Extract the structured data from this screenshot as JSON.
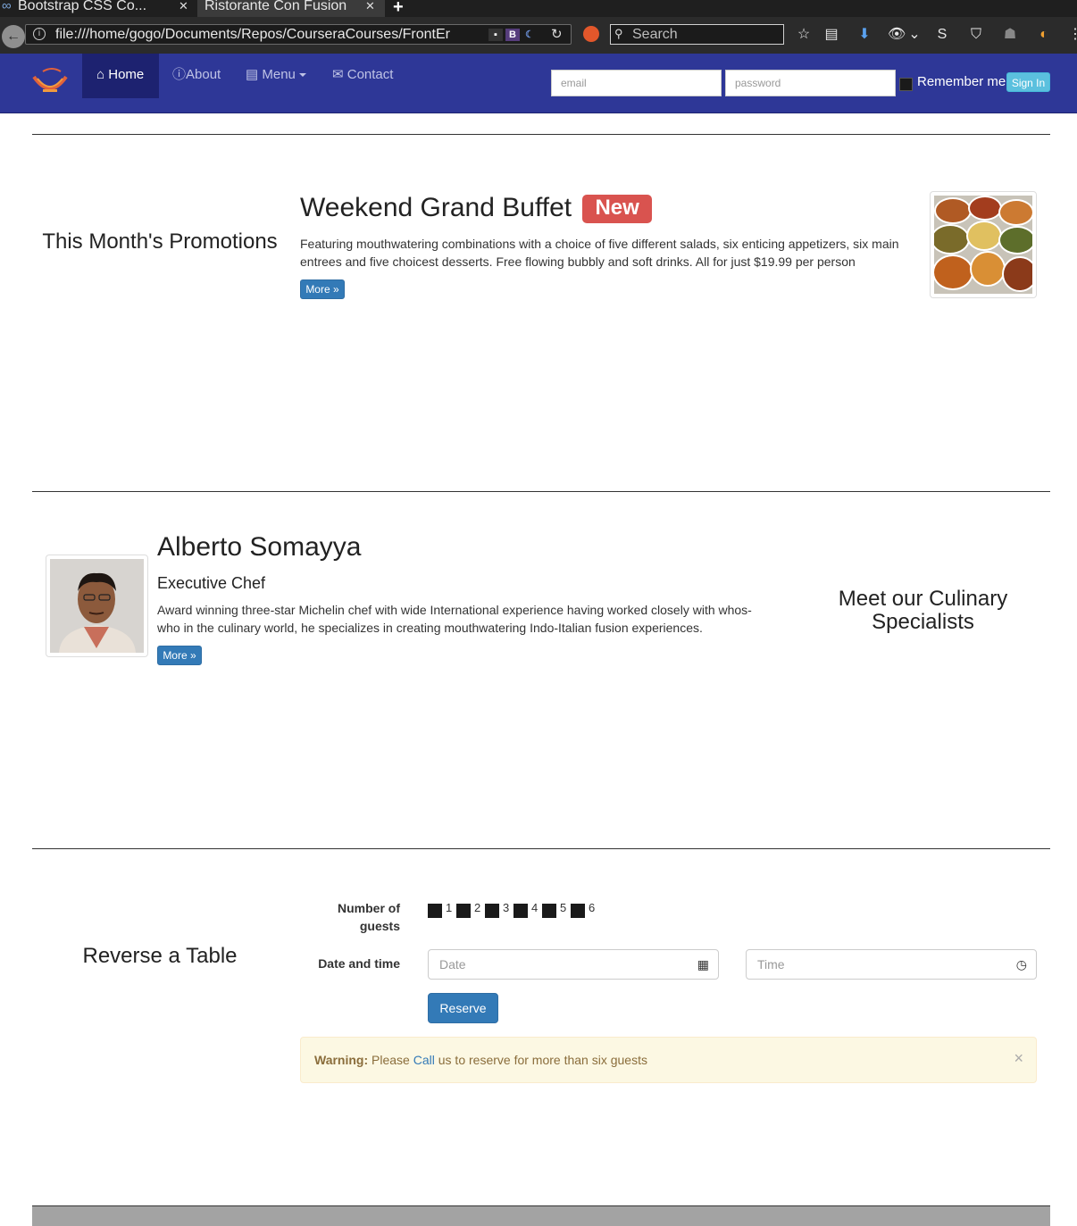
{
  "browser": {
    "tabs": [
      {
        "title": "Bootstrap CSS Co..."
      },
      {
        "title": "Ristorante Con Fusion"
      }
    ],
    "url": "file:///home/gogo/Documents/Repos/CourseraCourses/FrontEr",
    "search_placeholder": "Search"
  },
  "nav": {
    "home": "Home",
    "about": "About",
    "menu": "Menu",
    "contact": "Contact",
    "email_placeholder": "email",
    "password_placeholder": "password",
    "remember_me": "Remember me",
    "sign_in": "Sign In"
  },
  "promotions": {
    "section_title": "This Month's Promotions",
    "heading": "Weekend Grand Buffet",
    "badge": "New",
    "description": "Featuring mouthwatering combinations with a choice of five different salads, six enticing appetizers, six main entrees and five choicest desserts. Free flowing bubbly and soft drinks. All for just $19.99 per person",
    "more": "More »"
  },
  "specialists": {
    "section_title": "Meet our Culinary Specialists",
    "name": "Alberto Somayya",
    "role": "Executive Chef",
    "description": "Award winning three-star Michelin chef with wide International experience having worked closely with whos-who in the culinary world, he specializes in creating mouthwatering Indo-Italian fusion experiences.",
    "more": "More »"
  },
  "reservation": {
    "section_title": "Reverse a Table",
    "guests_label": "Number of guests",
    "guest_options": [
      "1",
      "2",
      "3",
      "4",
      "5",
      "6"
    ],
    "datetime_label": "Date and time",
    "date_placeholder": "Date",
    "time_placeholder": "Time",
    "reserve_button": "Reserve",
    "warning_strong": "Warning:",
    "warning_pre": "Please",
    "warning_link": "Call",
    "warning_post": "us to reserve for more than six guests",
    "close": "×"
  }
}
